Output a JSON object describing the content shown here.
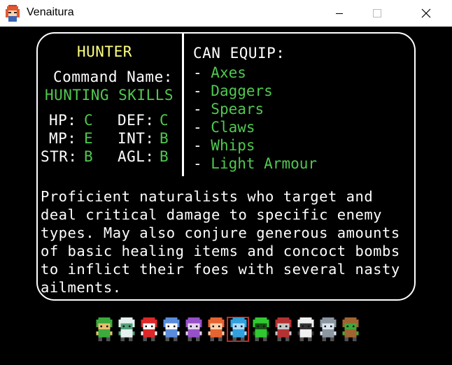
{
  "window": {
    "title": "Venaitura",
    "controls": [
      "minimize",
      "maximize",
      "close"
    ]
  },
  "class_info": {
    "name": "HUNTER",
    "command_label": "Command Name:",
    "command_value": "HUNTING SKILLS",
    "stats": [
      {
        "label": "HP:",
        "grade": "C"
      },
      {
        "label": "DEF:",
        "grade": "C"
      },
      {
        "label": "MP:",
        "grade": "E"
      },
      {
        "label": "INT:",
        "grade": "B"
      },
      {
        "label": "STR:",
        "grade": "B"
      },
      {
        "label": "AGL:",
        "grade": "B"
      }
    ]
  },
  "equipment": {
    "title": "CAN EQUIP:",
    "bullet": "- ",
    "items": [
      "Axes",
      "Daggers",
      "Spears",
      "Claws",
      "Whips",
      "Light Armour"
    ]
  },
  "description": "Proficient naturalists who target and deal critical damage to specific enemy types. May also conjure generous amounts of basic healing items and concoct bombs to inflict their foes with several nasty ailments.",
  "party_selector": {
    "selected_index": 6,
    "sprites": [
      {
        "name": "green-archer",
        "color": "#3caa3c",
        "accent": "#e8c070"
      },
      {
        "name": "white-spirit",
        "color": "#e6f0f0",
        "accent": "#50a078"
      },
      {
        "name": "red-imp",
        "color": "#dc2828",
        "accent": "#ffffff"
      },
      {
        "name": "blue-mage",
        "color": "#5a8cdc",
        "accent": "#ffffff"
      },
      {
        "name": "purple-witch",
        "color": "#9650c8",
        "accent": "#e6d2f0"
      },
      {
        "name": "orange-warrior",
        "color": "#e66432",
        "accent": "#ffd2aa"
      },
      {
        "name": "cyan-hunter",
        "color": "#32a0dc",
        "accent": "#aadcff"
      },
      {
        "name": "green-slime",
        "color": "#32c832",
        "accent": "#145014"
      },
      {
        "name": "red-knight",
        "color": "#b43232",
        "accent": "#c8c8c8"
      },
      {
        "name": "skull-ghost",
        "color": "#f0f0f0",
        "accent": "#323232"
      },
      {
        "name": "gray-rogue",
        "color": "#8c96a0",
        "accent": "#dce6f0"
      },
      {
        "name": "brown-ranger",
        "color": "#a06432",
        "accent": "#3caa3c"
      }
    ]
  }
}
